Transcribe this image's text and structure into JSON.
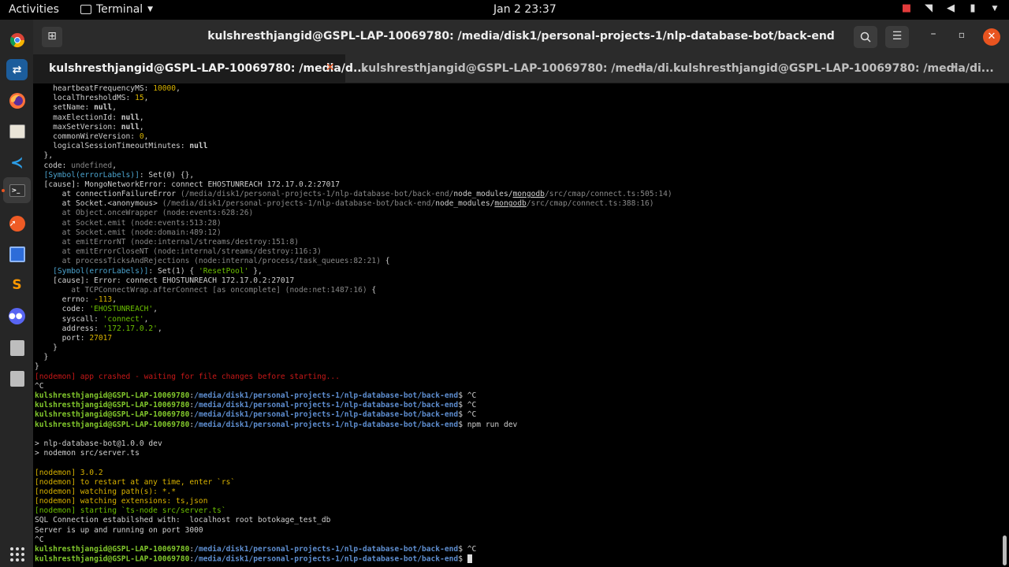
{
  "topbar": {
    "activities": "Activities",
    "app_name": "Terminal",
    "clock": "Jan 2  23:37",
    "icons": [
      "camera-icon",
      "wifi-icon",
      "volume-icon",
      "battery-icon",
      "chevron-down-icon"
    ]
  },
  "dock": {
    "items": [
      "chrome-icon",
      "remmina-icon",
      "firefox-icon",
      "files-icon",
      "vscode-icon",
      "terminal-icon",
      "postman-icon",
      "virtualbox-icon",
      "sublime-icon",
      "discord-icon",
      "drive-icon",
      "drive-icon"
    ],
    "apps_grid": "show-applications-icon"
  },
  "window": {
    "title": "kulshresthjangid@GSPL-LAP-10069780: /media/disk1/personal-projects-1/nlp-database-bot/back-end",
    "tabs": [
      {
        "label": "kulshresthjangid@GSPL-LAP-10069780: /media/d...",
        "active": true
      },
      {
        "label": "kulshresthjangid@GSPL-LAP-10069780: /media/di...",
        "active": false
      },
      {
        "label": "kulshresthjangid@GSPL-LAP-10069780: /media/di...",
        "active": false
      }
    ]
  },
  "terminal": {
    "prompt_user": "kulshresthjangid@GSPL-LAP-10069780",
    "prompt_path": "/media/disk1/personal-projects-1/nlp-database-bot/back-end",
    "lines": [
      {
        "parts": [
          [
            "    heartbeatFrequencyMS: ",
            ""
          ],
          [
            "10000",
            "y"
          ],
          [
            ",",
            ""
          ]
        ]
      },
      {
        "parts": [
          [
            "    localThresholdMS: ",
            ""
          ],
          [
            "15",
            "y"
          ],
          [
            ",",
            ""
          ]
        ]
      },
      {
        "parts": [
          [
            "    setName: ",
            ""
          ],
          [
            "null",
            "b"
          ],
          [
            ",",
            ""
          ]
        ]
      },
      {
        "parts": [
          [
            "    maxElectionId: ",
            ""
          ],
          [
            "null",
            "b"
          ],
          [
            ",",
            ""
          ]
        ]
      },
      {
        "parts": [
          [
            "    maxSetVersion: ",
            ""
          ],
          [
            "null",
            "b"
          ],
          [
            ",",
            ""
          ]
        ]
      },
      {
        "parts": [
          [
            "    commonWireVersion: ",
            ""
          ],
          [
            "0",
            "y"
          ],
          [
            ",",
            ""
          ]
        ]
      },
      {
        "parts": [
          [
            "    logicalSessionTimeoutMinutes: ",
            ""
          ],
          [
            "null",
            "b"
          ]
        ]
      },
      {
        "parts": [
          [
            "  },",
            ""
          ]
        ]
      },
      {
        "parts": [
          [
            "  code: ",
            ""
          ],
          [
            "undefined",
            "g"
          ],
          [
            ",",
            ""
          ]
        ]
      },
      {
        "parts": [
          [
            "  ",
            ""
          ],
          [
            "[Symbol(errorLabels)]",
            "c"
          ],
          [
            ": Set(0) {},",
            ""
          ]
        ]
      },
      {
        "parts": [
          [
            "  [cause]: MongoNetworkError: connect EHOSTUNREACH 172.17.0.2:27017",
            ""
          ]
        ]
      },
      {
        "parts": [
          [
            "      at connectionFailureError ",
            ""
          ],
          [
            "(/media/disk1/personal-projects-1/nlp-database-bot/back-end/",
            "g"
          ],
          [
            "node_modules/",
            ""
          ],
          [
            "mongodb",
            "u"
          ],
          [
            "/src/cmap/connect.ts:505:14",
            "g"
          ],
          [
            ")",
            "g"
          ]
        ]
      },
      {
        "parts": [
          [
            "      at Socket.<anonymous> ",
            ""
          ],
          [
            "(/media/disk1/personal-projects-1/nlp-database-bot/back-end/",
            "g"
          ],
          [
            "node_modules/",
            ""
          ],
          [
            "mongodb",
            "u"
          ],
          [
            "/src/cmap/connect.ts:388:16",
            "g"
          ],
          [
            ")",
            "g"
          ]
        ]
      },
      {
        "parts": [
          [
            "      at Object.onceWrapper (node:events:628:26)",
            "g"
          ]
        ]
      },
      {
        "parts": [
          [
            "      at Socket.emit (node:events:513:28)",
            "g"
          ]
        ]
      },
      {
        "parts": [
          [
            "      at Socket.emit (node:domain:489:12)",
            "g"
          ]
        ]
      },
      {
        "parts": [
          [
            "      at emitErrorNT (node:internal/streams/destroy:151:8)",
            "g"
          ]
        ]
      },
      {
        "parts": [
          [
            "      at emitErrorCloseNT (node:internal/streams/destroy:116:3)",
            "g"
          ]
        ]
      },
      {
        "parts": [
          [
            "      at processTicksAndRejections (node:internal/process/task_queues:82:21)",
            "g"
          ],
          [
            " {",
            ""
          ]
        ]
      },
      {
        "parts": [
          [
            "    ",
            ""
          ],
          [
            "[Symbol(errorLabels)]",
            "c"
          ],
          [
            ": Set(1) { ",
            ""
          ],
          [
            "'ResetPool'",
            "grn"
          ],
          [
            " },",
            ""
          ]
        ]
      },
      {
        "parts": [
          [
            "    [cause]: Error: connect EHOSTUNREACH 172.17.0.2:27017",
            ""
          ]
        ]
      },
      {
        "parts": [
          [
            "        at TCPConnectWrap.afterConnect [as oncomplete] (node:net:1487:16)",
            "g"
          ],
          [
            " {",
            ""
          ]
        ]
      },
      {
        "parts": [
          [
            "      errno: ",
            ""
          ],
          [
            "-113",
            "y"
          ],
          [
            ",",
            ""
          ]
        ]
      },
      {
        "parts": [
          [
            "      code: ",
            ""
          ],
          [
            "'EHOSTUNREACH'",
            "grn"
          ],
          [
            ",",
            ""
          ]
        ]
      },
      {
        "parts": [
          [
            "      syscall: ",
            ""
          ],
          [
            "'connect'",
            "grn"
          ],
          [
            ",",
            ""
          ]
        ]
      },
      {
        "parts": [
          [
            "      address: ",
            ""
          ],
          [
            "'172.17.0.2'",
            "grn"
          ],
          [
            ",",
            ""
          ]
        ]
      },
      {
        "parts": [
          [
            "      port: ",
            ""
          ],
          [
            "27017",
            "y"
          ]
        ]
      },
      {
        "parts": [
          [
            "    }",
            ""
          ]
        ]
      },
      {
        "parts": [
          [
            "  }",
            ""
          ]
        ]
      },
      {
        "parts": [
          [
            "}",
            ""
          ]
        ]
      },
      {
        "parts": [
          [
            "[nodemon] app crashed - waiting for file changes before starting...",
            "r"
          ]
        ]
      },
      {
        "parts": [
          [
            "^C",
            ""
          ]
        ]
      },
      {
        "prompt": true,
        "cmd": " ^C"
      },
      {
        "prompt": true,
        "cmd": " ^C"
      },
      {
        "prompt": true,
        "cmd": " ^C"
      },
      {
        "prompt": true,
        "cmd": " npm run dev"
      },
      {
        "parts": [
          [
            "",
            ""
          ]
        ]
      },
      {
        "parts": [
          [
            "> nlp-database-bot@1.0.0 dev",
            ""
          ]
        ]
      },
      {
        "parts": [
          [
            "> nodemon src/server.ts",
            ""
          ]
        ]
      },
      {
        "parts": [
          [
            "",
            ""
          ]
        ]
      },
      {
        "parts": [
          [
            "[nodemon] 3.0.2",
            "y"
          ]
        ]
      },
      {
        "parts": [
          [
            "[nodemon] to restart at any time, enter `rs`",
            "y"
          ]
        ]
      },
      {
        "parts": [
          [
            "[nodemon] watching path(s): *.*",
            "y"
          ]
        ]
      },
      {
        "parts": [
          [
            "[nodemon] watching extensions: ts,json",
            "y"
          ]
        ]
      },
      {
        "parts": [
          [
            "[nodemon] starting `ts-node src/server.ts`",
            "grn"
          ]
        ]
      },
      {
        "parts": [
          [
            "SQL Connection estabilshed with:  localhost root botokage_test_db",
            ""
          ]
        ]
      },
      {
        "parts": [
          [
            "Server is up and running on port 3000",
            ""
          ]
        ]
      },
      {
        "parts": [
          [
            "^C",
            ""
          ]
        ]
      },
      {
        "prompt": true,
        "cmd": " ^C"
      },
      {
        "prompt": true,
        "cmd": " ",
        "cursor": true
      }
    ]
  }
}
